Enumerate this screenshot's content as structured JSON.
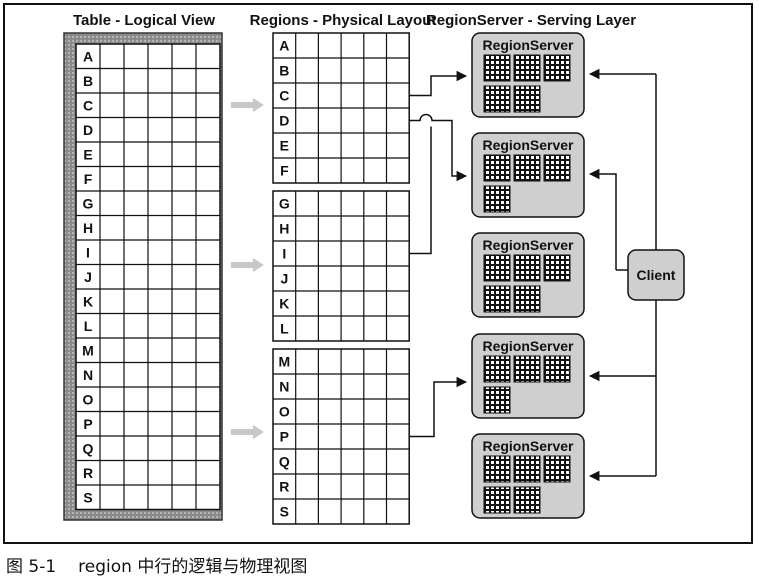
{
  "headings": {
    "logical": "Table - Logical View",
    "physical": "Regions - Physical Layout",
    "serving": "RegionServer - Serving Layer"
  },
  "rows": [
    "A",
    "B",
    "C",
    "D",
    "E",
    "F",
    "G",
    "H",
    "I",
    "J",
    "K",
    "L",
    "M",
    "N",
    "O",
    "P",
    "Q",
    "R",
    "S"
  ],
  "region_groups": [
    [
      "A",
      "B",
      "C",
      "D",
      "E",
      "F"
    ],
    [
      "G",
      "H",
      "I",
      "J",
      "K",
      "L"
    ],
    [
      "M",
      "N",
      "O",
      "P",
      "Q",
      "R",
      "S"
    ]
  ],
  "servers": [
    {
      "label": "RegionServer",
      "regions": 5
    },
    {
      "label": "RegionServer",
      "regions": 4
    },
    {
      "label": "RegionServer",
      "regions": 5
    },
    {
      "label": "RegionServer",
      "regions": 4
    },
    {
      "label": "RegionServer",
      "regions": 5
    }
  ],
  "client": {
    "label": "Client"
  },
  "caption": {
    "number": "图 5-1",
    "text": "region 中行的逻辑与物理视图"
  },
  "colors": {
    "table_border": "#9a9a9a",
    "server_fill": "#cfcfcf",
    "line": "#111111"
  }
}
